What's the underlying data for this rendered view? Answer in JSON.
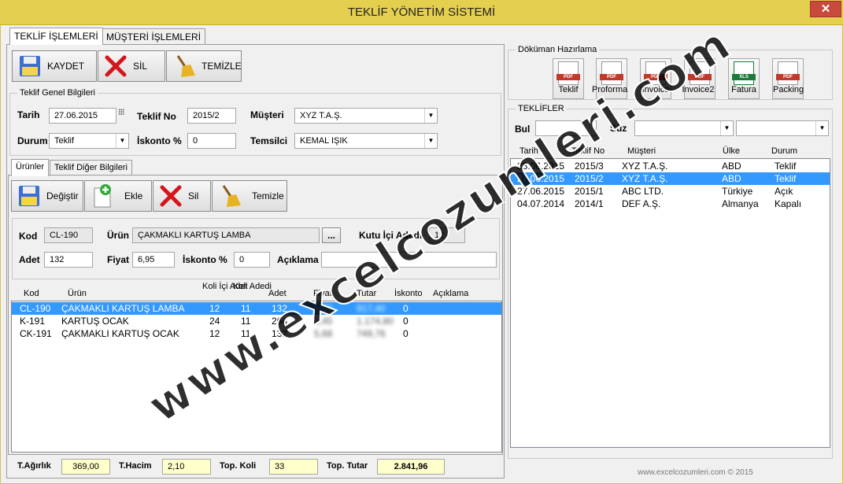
{
  "window": {
    "title": "TEKLİF YÖNETİM SİSTEMİ",
    "close": "✕"
  },
  "main_tabs": [
    {
      "label": "TEKLİF İŞLEMLERİ"
    },
    {
      "label": "MÜŞTERİ İŞLEMLERİ"
    }
  ],
  "toolbar": {
    "save": "KAYDET",
    "delete": "SİL",
    "clear": "TEMİZLE"
  },
  "general": {
    "group_label": "Teklif Genel Bilgileri",
    "date_label": "Tarih",
    "date": "27.06.2015",
    "offer_no_label": "Teklif No",
    "offer_no": "2015/2",
    "customer_label": "Müşteri",
    "customer": "XYZ T.A.Ş.",
    "status_label": "Durum",
    "status": "Teklif",
    "discount_label": "İskonto %",
    "discount": "0",
    "rep_label": "Temsilci",
    "rep": "KEMAL IŞIK"
  },
  "sub_tabs": [
    {
      "label": "Ürünler"
    },
    {
      "label": "Teklif Diğer Bilgileri"
    }
  ],
  "products_toolbar": {
    "change": "Değiştir",
    "add": "Ekle",
    "delete": "Sil",
    "clear": "Temizle"
  },
  "product_form": {
    "code_label": "Kod",
    "code": "CL-190",
    "product_label": "Ürün",
    "product": "ÇAKMAKLI KARTUŞ LAMBA",
    "browse": "...",
    "box_qty_label": "Kutu İçi Adedi",
    "box_qty": "12",
    "qty_label": "Adet",
    "qty": "132",
    "price_label": "Fiyat",
    "price": "6,95",
    "discount_label": "İskonto %",
    "discount": "0",
    "note_label": "Açıklama",
    "note": ""
  },
  "product_columns": [
    "Kod",
    "Ürün",
    "Koli İçi Adet",
    "Koli Adedi",
    "Adet",
    "Fiyat",
    "Tutar",
    "İskonto",
    "Açıklama"
  ],
  "product_rows": [
    {
      "code": "CL-190",
      "product": "ÇAKMAKLI KARTUŞ LAMBA",
      "box_qty": "12",
      "boxes": "11",
      "qty": "132",
      "price": "6,95",
      "total": "917,40",
      "discount": "0",
      "note": ""
    },
    {
      "code": "K-191",
      "product": "KARTUŞ OCAK",
      "box_qty": "24",
      "boxes": "11",
      "qty": "264",
      "price": "4,45",
      "total": "1.174,80",
      "discount": "0",
      "note": ""
    },
    {
      "code": "CK-191",
      "product": "ÇAKMAKLI KARTUŞ OCAK",
      "box_qty": "12",
      "boxes": "11",
      "qty": "132",
      "price": "5,68",
      "total": "749,76",
      "discount": "0",
      "note": ""
    }
  ],
  "totals": {
    "weight_label": "T.Ağırlık",
    "weight": "369,00",
    "volume_label": "T.Hacim",
    "volume": "2,10",
    "boxes_label": "Top. Koli",
    "boxes": "33",
    "sum_label": "Top. Tutar",
    "sum": "2.841,96"
  },
  "documents": {
    "group_label": "Döküman Hazırlama",
    "buttons": [
      "Teklif",
      "Proforma",
      "Invoice",
      "Invoice2",
      "Fatura",
      "Packing"
    ]
  },
  "offers": {
    "group_label": "TEKLİFLER",
    "find_label": "Bul",
    "find_value": "",
    "filter_label": "Süz",
    "filter1": "",
    "filter2": "",
    "columns": [
      "Tarih",
      "Teklif No",
      "Müşteri",
      "Ülke",
      "Durum"
    ],
    "rows": [
      {
        "date": "28.06.2015",
        "no": "2015/3",
        "customer": "XYZ T.A.Ş.",
        "country": "ABD",
        "status": "Teklif"
      },
      {
        "date": "27.06.2015",
        "no": "2015/2",
        "customer": "XYZ T.A.Ş.",
        "country": "ABD",
        "status": "Teklif"
      },
      {
        "date": "27.06.2015",
        "no": "2015/1",
        "customer": "ABC LTD.",
        "country": "Türkiye",
        "status": "Açık"
      },
      {
        "date": "04.07.2014",
        "no": "2014/1",
        "customer": "DEF A.Ş.",
        "country": "Almanya",
        "status": "Kapalı"
      }
    ]
  },
  "footer": "www.excelcozumleri.com © 2015",
  "watermark": "www.excelcozumleri.com"
}
